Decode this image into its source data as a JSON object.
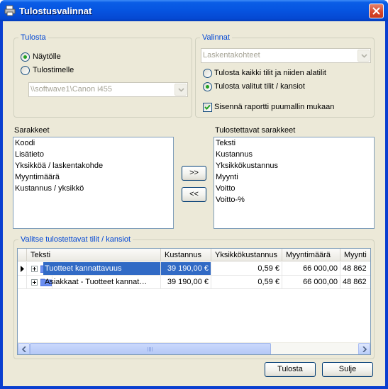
{
  "window": {
    "title": "Tulostusvalinnat"
  },
  "tulosta_group": {
    "legend": "Tulosta",
    "option_screen": "Näytölle",
    "option_printer": "Tulostimelle",
    "printer_value": "\\\\softwave1\\Canon i455",
    "selected": "Näytölle"
  },
  "valinnat_group": {
    "legend": "Valinnat",
    "combo_value": "Laskentakohteet",
    "option_all": "Tulosta kaikki tilit ja niiden alatilit",
    "option_selected": "Tulosta valitut tilit / kansiot",
    "selected": "Tulosta valitut tilit / kansiot",
    "indent_label": "Sisennä raportti puumallin mukaan",
    "indent_checked": true
  },
  "columns": {
    "available_label": "Sarakkeet",
    "available": [
      "Koodi",
      "Lisätieto",
      "Yksikköä / laskentakohde",
      "Myyntimäärä",
      "Kustannus / yksikkö"
    ],
    "add_button": ">>",
    "remove_button": "<<",
    "selected_label": "Tulostettavat sarakkeet",
    "selected": [
      "Teksti",
      "Kustannus",
      "Yksikkökustannus",
      "Myynti",
      "Voitto",
      "Voitto-%"
    ]
  },
  "accounts": {
    "legend": "Valitse tulostettavat tilit / kansiot",
    "headers": [
      "Teksti",
      "Kustannus",
      "Yksikkökustannus",
      "Myyntimäärä",
      "Myynti"
    ],
    "rows": [
      {
        "text": "Tuotteet kannattavuus",
        "cost": "39 190,00 €",
        "unit_cost": "0,59 €",
        "sales_qty": "66 000,00",
        "sales": "48 862",
        "selected": true
      },
      {
        "text": "Asiakkaat - Tuotteet kannat…",
        "cost": "39 190,00 €",
        "unit_cost": "0,59 €",
        "sales_qty": "66 000,00",
        "sales": "48 862",
        "selected": false
      }
    ]
  },
  "footer": {
    "print_button": "Tulosta",
    "close_button": "Sulje"
  },
  "colors": {
    "title_bar": "#0654e0",
    "selection": "#316ac5",
    "legend_text": "#0046d5",
    "client_bg": "#ece9d8"
  }
}
